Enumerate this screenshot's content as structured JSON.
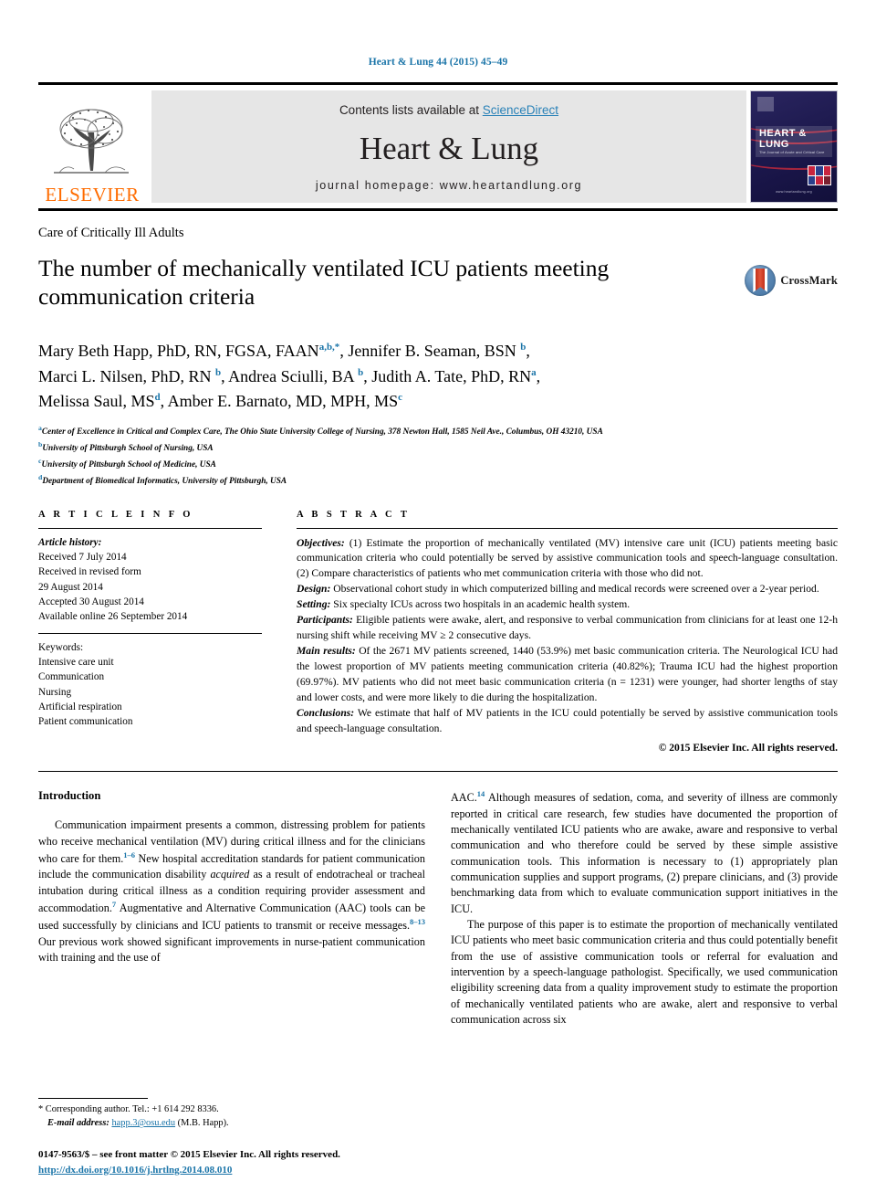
{
  "running_head": "Heart & Lung 44 (2015) 45–49",
  "masthead": {
    "publisher_name": "ELSEVIER",
    "contents_prefix": "Contents lists available at ",
    "sciencedirect_link": "ScienceDirect",
    "journal_title": "Heart & Lung",
    "homepage_line": "journal homepage: www.heartandlung.org",
    "cover": {
      "title": "HEART & LUNG",
      "subtitle": "The Journal of Acute and Critical Care",
      "url": "www.heartandlung.org"
    },
    "link_color": "#2a82b8",
    "elsevier_color": "#ff6c00"
  },
  "article": {
    "section_label": "Care of Critically Ill Adults",
    "title": "The number of mechanically ventilated ICU patients meeting communication criteria",
    "crossmark_label": "CrossMark",
    "authors_line_1": "Mary Beth Happ, PhD, RN, FGSA, FAAN a,b,*, Jennifer B. Seaman, BSN b,",
    "authors_line_2": "Marci L. Nilsen, PhD, RN b, Andrea Sciulli, BA b, Judith A. Tate, PhD, RN a,",
    "authors_line_3": "Melissa Saul, MS d, Amber E. Barnato, MD, MPH, MS c",
    "affiliations": [
      {
        "marker": "a",
        "text": "Center of Excellence in Critical and Complex Care, The Ohio State University College of Nursing, 378 Newton Hall, 1585 Neil Ave., Columbus, OH 43210, USA"
      },
      {
        "marker": "b",
        "text": "University of Pittsburgh School of Nursing, USA"
      },
      {
        "marker": "c",
        "text": "University of Pittsburgh School of Medicine, USA"
      },
      {
        "marker": "d",
        "text": "Department of Biomedical Informatics, University of Pittsburgh, USA"
      }
    ]
  },
  "article_info": {
    "heading": "A R T I C L E   I N F O",
    "history_label": "Article history:",
    "history": [
      "Received 7 July 2014",
      "Received in revised form",
      "29 August 2014",
      "Accepted 30 August 2014",
      "Available online 26 September 2014"
    ],
    "keywords_label": "Keywords:",
    "keywords": [
      "Intensive care unit",
      "Communication",
      "Nursing",
      "Artificial respiration",
      "Patient communication"
    ]
  },
  "abstract": {
    "heading": "A B S T R A C T",
    "sections": [
      {
        "label": "Objectives:",
        "text": " (1) Estimate the proportion of mechanically ventilated (MV) intensive care unit (ICU) patients meeting basic communication criteria who could potentially be served by assistive communication tools and speech-language consultation. (2) Compare characteristics of patients who met communication criteria with those who did not."
      },
      {
        "label": "Design:",
        "text": " Observational cohort study in which computerized billing and medical records were screened over a 2-year period."
      },
      {
        "label": "Setting:",
        "text": " Six specialty ICUs across two hospitals in an academic health system."
      },
      {
        "label": "Participants:",
        "text": " Eligible patients were awake, alert, and responsive to verbal communication from clinicians for at least one 12-h nursing shift while receiving MV ≥ 2 consecutive days."
      },
      {
        "label": "Main results:",
        "text": " Of the 2671 MV patients screened, 1440 (53.9%) met basic communication criteria. The Neurological ICU had the lowest proportion of MV patients meeting communication criteria (40.82%); Trauma ICU had the highest proportion (69.97%). MV patients who did not meet basic communication criteria (n = 1231) were younger, had shorter lengths of stay and lower costs, and were more likely to die during the hospitalization."
      },
      {
        "label": "Conclusions:",
        "text": " We estimate that half of MV patients in the ICU could potentially be served by assistive communication tools and speech-language consultation."
      }
    ],
    "copyright": "© 2015 Elsevier Inc. All rights reserved."
  },
  "body": {
    "left_heading": "Introduction",
    "left_paragraph_1_a": "Communication impairment presents a common, distressing problem for patients who receive mechanical ventilation (MV) during critical illness and for the clinicians who care for them.",
    "left_ref_1": "1–6",
    "left_paragraph_1_b": " New hospital accreditation standards for patient communication include the communication disability ",
    "left_italic_1": "acquired",
    "left_paragraph_1_c": " as a result of endotracheal or tracheal intubation during critical illness as a condition requiring provider assessment and accommodation.",
    "left_ref_2": "7",
    "left_paragraph_1_d": " Augmentative and Alternative Communication (AAC) tools can be used successfully by clinicians and ICU patients to transmit or receive messages.",
    "left_ref_3": "8–13",
    "left_paragraph_1_e": " Our previous work showed significant improvements in nurse-patient communication with training and the use of",
    "right_paragraph_1_a": "AAC.",
    "right_ref_1": "14",
    "right_paragraph_1_b": " Although measures of sedation, coma, and severity of illness are commonly reported in critical care research, few studies have documented the proportion of mechanically ventilated ICU patients who are awake, aware and responsive to verbal communication and who therefore could be served by these simple assistive communication tools. This information is necessary to (1) appropriately plan communication supplies and support programs, (2) prepare clinicians, and (3) provide benchmarking data from which to evaluate communication support initiatives in the ICU.",
    "right_paragraph_2": "The purpose of this paper is to estimate the proportion of mechanically ventilated ICU patients who meet basic communication criteria and thus could potentially benefit from the use of assistive communication tools or referral for evaluation and intervention by a speech-language pathologist. Specifically, we used communication eligibility screening data from a quality improvement study to estimate the proportion of mechanically ventilated patients who are awake, alert and responsive to verbal communication across six"
  },
  "footnotes": {
    "corresponding": "* Corresponding author. Tel.: +1 614 292 8336.",
    "email_label": "E-mail address:",
    "email": "happ.3@osu.edu",
    "email_suffix": " (M.B. Happ).",
    "issn_line": "0147-9563/$ – see front matter © 2015 Elsevier Inc. All rights reserved.",
    "doi": "http://dx.doi.org/10.1016/j.hrtlng.2014.08.010"
  }
}
